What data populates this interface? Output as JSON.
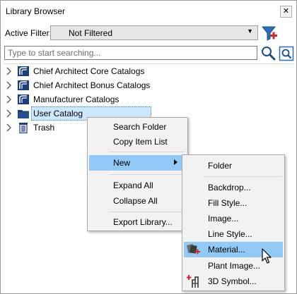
{
  "window": {
    "title": "Library Browser",
    "close_glyph": "✕"
  },
  "filter": {
    "label": "Active Filter:",
    "value": "Not Filtered"
  },
  "search": {
    "placeholder": "Type to start searching..."
  },
  "tree": {
    "items": [
      {
        "label": "Chief Architect Core Catalogs",
        "icon": "catalog-icon"
      },
      {
        "label": "Chief Architect Bonus Catalogs",
        "icon": "catalog-icon"
      },
      {
        "label": "Manufacturer Catalogs",
        "icon": "catalog-icon"
      },
      {
        "label": "User Catalog",
        "icon": "folder-icon",
        "selected": true
      },
      {
        "label": "Trash",
        "icon": "trash-icon"
      }
    ]
  },
  "context_menu": {
    "items": [
      {
        "label": "Search Folder"
      },
      {
        "label": "Copy Item List"
      },
      {
        "label": "New",
        "submenu": true,
        "highlighted": true
      },
      {
        "label": "Expand All"
      },
      {
        "label": "Collapse All"
      },
      {
        "label": "Export Library..."
      }
    ]
  },
  "new_submenu": {
    "items": [
      {
        "label": "Folder"
      },
      {
        "label": "Backdrop..."
      },
      {
        "label": "Fill Style..."
      },
      {
        "label": "Image..."
      },
      {
        "label": "Line Style..."
      },
      {
        "label": "Material...",
        "highlighted": true,
        "icon": "material-icon"
      },
      {
        "label": "Plant Image..."
      },
      {
        "label": "3D Symbol...",
        "icon": "symbol-3d-icon"
      }
    ]
  },
  "colors": {
    "selection": "#cce8ff",
    "menu_highlight": "#91c9f7",
    "catalog_blue": "#1c3f7a",
    "accent_red": "#d9262b"
  }
}
